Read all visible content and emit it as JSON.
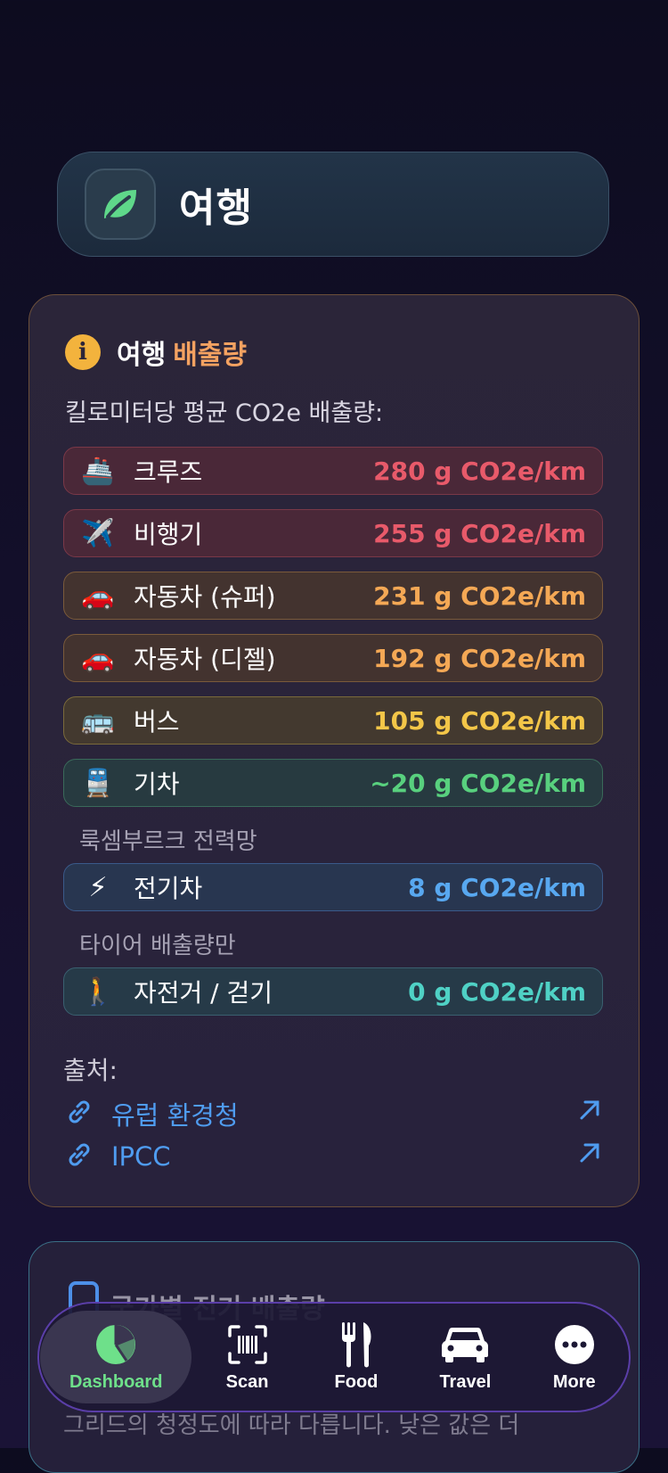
{
  "header": {
    "title": "여행"
  },
  "card": {
    "title_part1": "여행",
    "title_part2": "배출량",
    "subtitle": "킬로미터당 평균 CO2e 배출량:",
    "rows": [
      {
        "emoji": "🚢",
        "label": "크루즈",
        "value": "280 g CO2e/km",
        "color": "#e85a6a",
        "bg": "#4a2838",
        "border": "#7a3848"
      },
      {
        "emoji": "✈️",
        "label": "비행기",
        "value": "255 g CO2e/km",
        "color": "#e85a6a",
        "bg": "#4a2838",
        "border": "#7a3848"
      },
      {
        "emoji": "🚗",
        "label": "자동차 (슈퍼)",
        "value": "231 g CO2e/km",
        "color": "#f4a855",
        "bg": "#43332f",
        "border": "#7a5a3a"
      },
      {
        "emoji": "🚗",
        "label": "자동차 (디젤)",
        "value": "192 g CO2e/km",
        "color": "#f4a855",
        "bg": "#43332f",
        "border": "#7a5a3a"
      },
      {
        "emoji": "🚌",
        "label": "버스",
        "value": "105 g CO2e/km",
        "color": "#f3c648",
        "bg": "#43392f",
        "border": "#7a6a3a"
      },
      {
        "emoji": "🚆",
        "label": "기차",
        "value": "~20 g CO2e/km",
        "color": "#58d07e",
        "bg": "#273a40",
        "border": "#3a6a5a"
      },
      {
        "emoji": "⚡",
        "label": "전기차",
        "value": "8 g CO2e/km",
        "color": "#58a8f0",
        "bg": "#283650",
        "border": "#3a5a8a"
      },
      {
        "emoji": "🚶",
        "label": "자전거 / 걷기",
        "value": "0 g CO2e/km",
        "color": "#4fd1c5",
        "bg": "#263a48",
        "border": "#3a6070"
      }
    ],
    "notes": {
      "train": "룩셈부르크 전력망",
      "ev": "타이어 배출량만"
    },
    "sources_label": "출처:",
    "sources": [
      "유럽 환경청",
      "IPCC"
    ]
  },
  "card2": {
    "title": "국가별 전기 배출량",
    "text": "그리드의 청정도에 따라 다릅니다. 낮은 값은 더"
  },
  "tabs": [
    {
      "label": "Dashboard",
      "active": true
    },
    {
      "label": "Scan"
    },
    {
      "label": "Food"
    },
    {
      "label": "Travel"
    },
    {
      "label": "More"
    }
  ]
}
